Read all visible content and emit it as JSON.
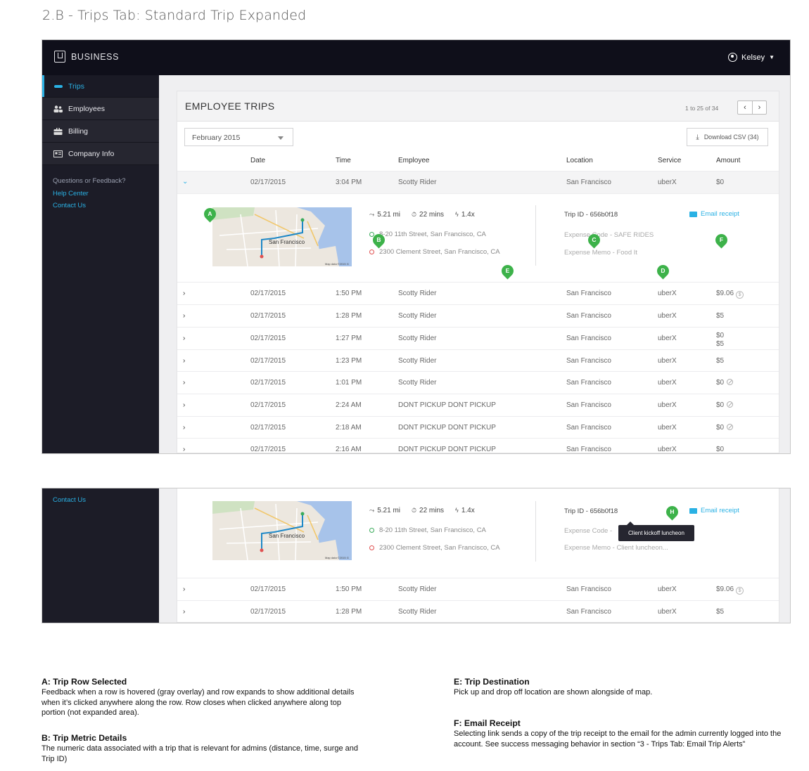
{
  "doc_title": "2.B - Trips Tab: Standard Trip Expanded",
  "topbar": {
    "brand": "BUSINESS",
    "user": "Kelsey"
  },
  "sidebar": {
    "items": [
      {
        "label": "Trips",
        "icon": "car-icon"
      },
      {
        "label": "Employees",
        "icon": "users-icon"
      },
      {
        "label": "Billing",
        "icon": "briefcase-icon"
      },
      {
        "label": "Company Info",
        "icon": "card-icon"
      }
    ],
    "question": "Questions or Feedback?",
    "help": "Help Center",
    "contact": "Contact Us"
  },
  "panel": {
    "title": "EMPLOYEE TRIPS",
    "pager": "1 to 25 of 34",
    "month": "February 2015",
    "csv": "Download CSV (34)"
  },
  "columns": {
    "date": "Date",
    "time": "Time",
    "employee": "Employee",
    "location": "Location",
    "service": "Service",
    "amount": "Amount"
  },
  "rows": [
    {
      "date": "02/17/2015",
      "time": "3:04 PM",
      "employee": "Scotty Rider",
      "location": "San Francisco",
      "service": "uberX",
      "amount": "$0"
    },
    {
      "date": "02/17/2015",
      "time": "1:50 PM",
      "employee": "Scotty Rider",
      "location": "San Francisco",
      "service": "uberX",
      "amount": "$9.06"
    },
    {
      "date": "02/17/2015",
      "time": "1:28 PM",
      "employee": "Scotty Rider",
      "location": "San Francisco",
      "service": "uberX",
      "amount": "$5"
    },
    {
      "date": "02/17/2015",
      "time": "1:27 PM",
      "employee": "Scotty Rider",
      "location": "San Francisco",
      "service": "uberX",
      "amount": "$0",
      "amount2": "$5"
    },
    {
      "date": "02/17/2015",
      "time": "1:23 PM",
      "employee": "Scotty Rider",
      "location": "San Francisco",
      "service": "uberX",
      "amount": "$5"
    },
    {
      "date": "02/17/2015",
      "time": "1:01 PM",
      "employee": "Scotty Rider",
      "location": "San Francisco",
      "service": "uberX",
      "amount": "$0"
    },
    {
      "date": "02/17/2015",
      "time": "2:24 AM",
      "employee": "DONT PICKUP DONT PICKUP",
      "location": "San Francisco",
      "service": "uberX",
      "amount": "$0"
    },
    {
      "date": "02/17/2015",
      "time": "2:18 AM",
      "employee": "DONT PICKUP DONT PICKUP",
      "location": "San Francisco",
      "service": "uberX",
      "amount": "$0"
    },
    {
      "date": "02/17/2015",
      "time": "2:16 AM",
      "employee": "DONT PICKUP DONT PICKUP",
      "location": "San Francisco",
      "service": "uberX",
      "amount": "$0"
    }
  ],
  "trip": {
    "distance": "5.21 mi",
    "duration": "22 mins",
    "surge": "1.4x",
    "pickup": "8-20 11th Street, San Francisco, CA",
    "dropoff": "2300 Clement Street, San Francisco, CA",
    "trip_id": "Trip ID - 656b0f18",
    "expense_code": "Expense Code - SAFE RIDES",
    "expense_memo": "Expense Memo - Food It",
    "email": "Email receipt",
    "map_city": "San Francisco",
    "map_credit": "Map data ©2015 G"
  },
  "frame2": {
    "expense_code": "Expense Code -",
    "expense_memo": "Expense Memo - Client luncheon...",
    "tooltip": "Client kickoff luncheon"
  },
  "pins": [
    "A",
    "B",
    "C",
    "D",
    "E",
    "F",
    "H"
  ],
  "notes": [
    {
      "title": "A: Trip Row Selected",
      "body": "Feedback when a row is hovered (gray overlay) and row expands to show additional details when it’s clicked anywhere along the row. Row closes when clicked anywhere along top portion (not expanded area)."
    },
    {
      "title": "B: Trip Metric Details",
      "body": "The numeric data associated with a trip that is relevant for admins (distance, time, surge and Trip ID)"
    },
    {
      "title": "E: Trip Destination",
      "body": "Pick up and drop off location are shown alongside of map."
    },
    {
      "title": "F: Email Receipt",
      "body": "Selecting link sends a copy of the trip receipt to the email for the admin currently logged into the account. See success messaging behavior in section “3 - Trips Tab: Email Trip Alerts”"
    }
  ]
}
